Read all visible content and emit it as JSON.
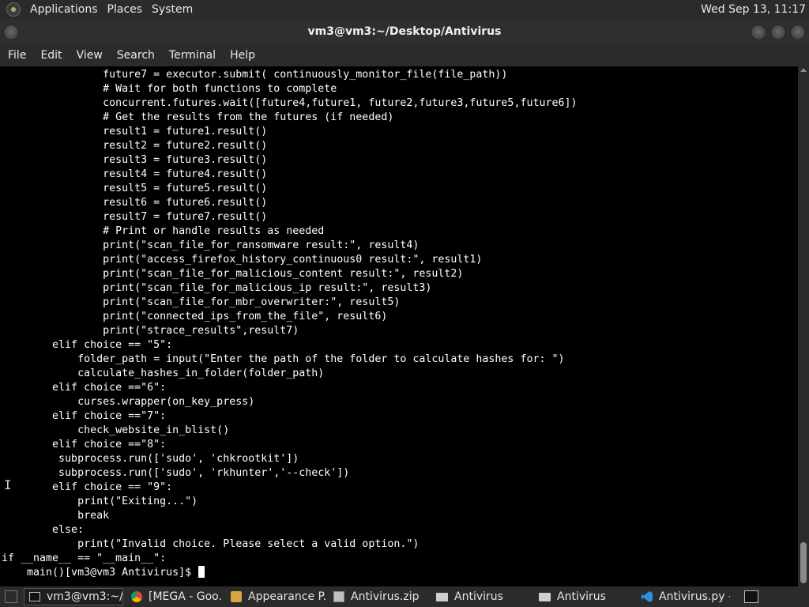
{
  "top_panel": {
    "menus": [
      "Applications",
      "Places",
      "System"
    ],
    "clock": "Wed Sep 13, 11:17"
  },
  "window": {
    "title": "vm3@vm3:~/Desktop/Antivirus"
  },
  "menubar": [
    "File",
    "Edit",
    "View",
    "Search",
    "Terminal",
    "Help"
  ],
  "terminal": {
    "lines": [
      "                future7 = executor.submit( continuously_monitor_file(file_path))",
      "                # Wait for both functions to complete",
      "                concurrent.futures.wait([future4,future1, future2,future3,future5,future6])",
      "                # Get the results from the futures (if needed)",
      "                result1 = future1.result()",
      "                result2 = future2.result()",
      "                result3 = future3.result()",
      "                result4 = future4.result()",
      "                result5 = future5.result()",
      "                result6 = future6.result()",
      "                result7 = future7.result()",
      "                # Print or handle results as needed",
      "                print(\"scan_file_for_ransomware result:\", result4)",
      "                print(\"access_firefox_history_continuous0 result:\", result1)",
      "                print(\"scan_file_for_malicious_content result:\", result2)",
      "                print(\"scan_file_for_malicious_ip result:\", result3)",
      "                print(\"scan_file_for_mbr_overwriter:\", result5)",
      "                print(\"connected_ips_from_the_file\", result6)",
      "                print(\"strace_results\",result7)",
      "        elif choice == \"5\":",
      "            folder_path = input(\"Enter the path of the folder to calculate hashes for: \")",
      "            calculate_hashes_in_folder(folder_path)",
      "        elif choice ==\"6\":",
      "            curses.wrapper(on_key_press)",
      "        elif choice ==\"7\":",
      "            check_website_in_blist()",
      "        elif choice ==\"8\":",
      "         subprocess.run(['sudo', 'chkrootkit'])",
      "         subprocess.run(['sudo', 'rkhunter','--check'])",
      "        elif choice == \"9\":",
      "            print(\"Exiting...\")",
      "            break",
      "        else:",
      "            print(\"Invalid choice. Please select a valid option.\")",
      "if __name__ == \"__main__\":",
      "    main()[vm3@vm3 Antivirus]$ "
    ]
  },
  "taskbar": {
    "tasks": [
      {
        "label": "vm3@vm3:~/...",
        "icon": "terminal-icon",
        "active": true
      },
      {
        "label": "[MEGA - Goo...",
        "icon": "chrome-icon",
        "active": false
      },
      {
        "label": "Appearance P...",
        "icon": "appearance-icon",
        "active": false
      },
      {
        "label": "Antivirus.zip",
        "icon": "archive-icon",
        "active": false
      },
      {
        "label": "Antivirus",
        "icon": "folder-icon",
        "active": false
      },
      {
        "label": "Antivirus",
        "icon": "folder-icon",
        "active": false
      },
      {
        "label": "Antivirus.py - ...",
        "icon": "vscode-icon",
        "active": false
      }
    ]
  }
}
